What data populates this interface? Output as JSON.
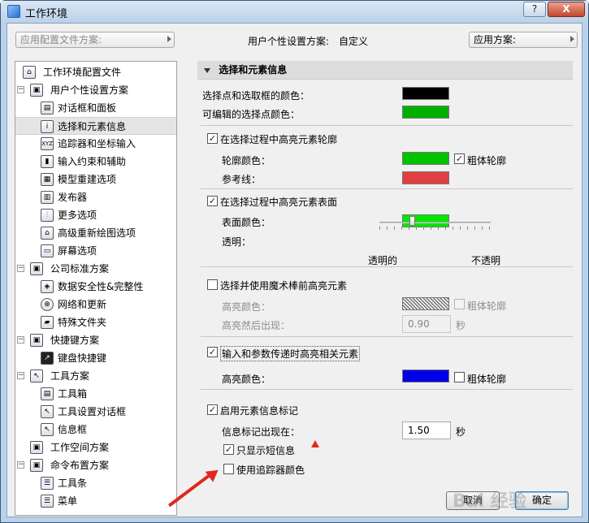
{
  "window": {
    "title": "工作环境",
    "help_btn": "?",
    "close_btn": "X"
  },
  "top": {
    "profile_combo_placeholder": "应用配置文件方案:",
    "profile_label": "用户个性设置方案:",
    "profile_value": "自定义",
    "apply_scheme": "应用方案:"
  },
  "tree": {
    "items": [
      {
        "label": "工作环境配置文件"
      },
      {
        "label": "用户个性设置方案"
      },
      {
        "label": "对话框和面板"
      },
      {
        "label": "选择和元素信息"
      },
      {
        "label": "追踪器和坐标输入"
      },
      {
        "label": "输入约束和辅助"
      },
      {
        "label": "模型重建选项"
      },
      {
        "label": "发布器"
      },
      {
        "label": "更多选项"
      },
      {
        "label": "高级重新绘图选项"
      },
      {
        "label": "屏幕选项"
      },
      {
        "label": "公司标准方案"
      },
      {
        "label": "数据安全性&完整性"
      },
      {
        "label": "网络和更新"
      },
      {
        "label": "特殊文件夹"
      },
      {
        "label": "快捷键方案"
      },
      {
        "label": "键盘快捷键"
      },
      {
        "label": "工具方案"
      },
      {
        "label": "工具箱"
      },
      {
        "label": "工具设置对话框"
      },
      {
        "label": "信息框"
      },
      {
        "label": "工作空间方案"
      },
      {
        "label": "命令布置方案"
      },
      {
        "label": "工具条"
      },
      {
        "label": "菜单"
      }
    ],
    "selected": "选择和元素信息"
  },
  "panel": {
    "section_title": "选择和元素信息",
    "sel_color_label": "选择点和选取框的颜色：",
    "sel_color": "#000000",
    "editable_color_label": "可编辑的选择点颜色：",
    "editable_color": "#00b000",
    "highlight_contour_label": "在选择过程中高亮元素轮廓",
    "contour_color_label": "轮廓颜色：",
    "contour_color": "#00c400",
    "thick_contour_label": "粗体轮廓",
    "ref_line_label": "参考线：",
    "ref_line_color": "#e04040",
    "highlight_surface_label": "在选择过程中高亮元素表面",
    "surface_color_label": "表面颜色：",
    "surface_color": "#00e800",
    "transparency_label": "透明：",
    "transparent_label": "透明的",
    "opaque_label": "不透明",
    "magic_wand_label": "选择并使用魔术棒前高亮元素",
    "hl_color_label": "高亮颜色：",
    "hl_thick_label": "粗体轮廓",
    "hl_delay_label": "高亮然后出现：",
    "hl_delay_value": "0.90",
    "seconds": "秒",
    "input_hl_label": "输入和参数传递时高亮相关元素",
    "input_hl_color_label": "高亮颜色：",
    "input_hl_color": "#0000e8",
    "input_thick_label": "粗体轮廓",
    "info_tag_label": "启用元素信息标记",
    "info_tag_delay_label": "信息标记出现在：",
    "info_tag_delay_value": "1.50",
    "info_seconds": "秒",
    "short_info_label": "只显示短信息",
    "tracker_color_label": "使用追踪器颜色"
  },
  "buttons": {
    "cancel": "取消",
    "ok": "确定"
  },
  "watermark": "Bai 经验"
}
